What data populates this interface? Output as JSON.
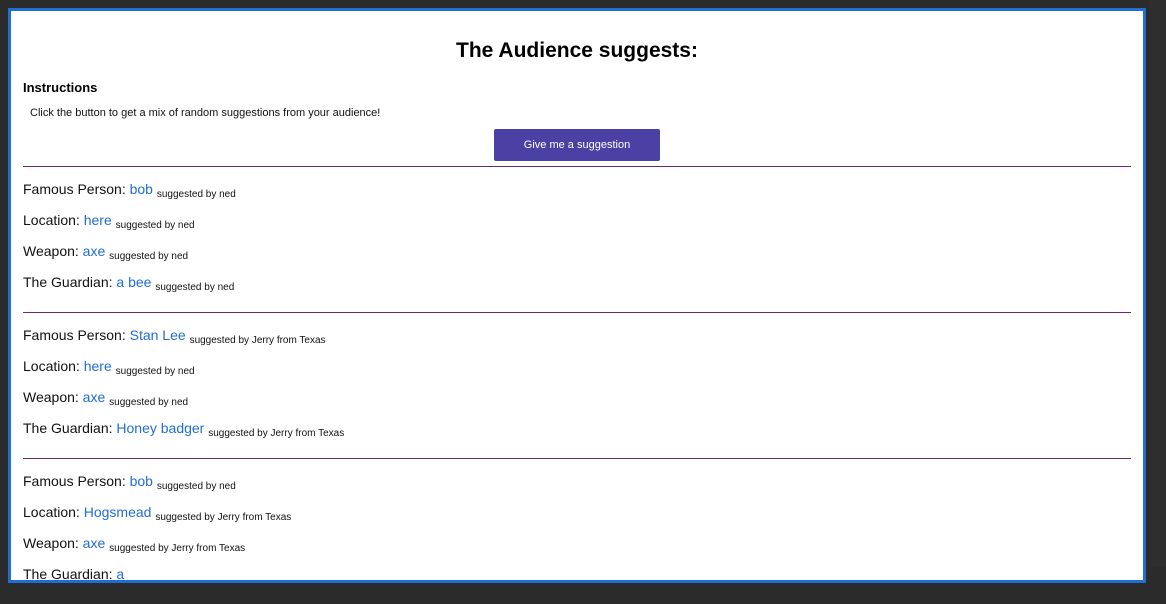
{
  "page": {
    "title": "The Audience suggests:",
    "instructions_heading": "Instructions",
    "instructions_text": "Click the button to get a mix of random suggestions from your audience!",
    "button_label": "Give me a suggestion"
  },
  "groups": [
    {
      "rows": [
        {
          "label": "Famous Person:",
          "value": "bob",
          "by": "suggested by ned"
        },
        {
          "label": "Location:",
          "value": "here",
          "by": "suggested by ned"
        },
        {
          "label": "Weapon:",
          "value": "axe",
          "by": "suggested by ned"
        },
        {
          "label": "The Guardian:",
          "value": "a bee",
          "by": "suggested by ned"
        }
      ]
    },
    {
      "rows": [
        {
          "label": "Famous Person:",
          "value": "Stan Lee",
          "by": "suggested by Jerry from Texas"
        },
        {
          "label": "Location:",
          "value": "here",
          "by": "suggested by ned"
        },
        {
          "label": "Weapon:",
          "value": "axe",
          "by": "suggested by ned"
        },
        {
          "label": "The Guardian:",
          "value": "Honey badger",
          "by": "suggested by Jerry from Texas"
        }
      ]
    },
    {
      "rows": [
        {
          "label": "Famous Person:",
          "value": "bob",
          "by": "suggested by ned"
        },
        {
          "label": "Location:",
          "value": "Hogsmead",
          "by": "suggested by Jerry from Texas"
        },
        {
          "label": "Weapon:",
          "value": "axe",
          "by": "suggested by Jerry from Texas"
        },
        {
          "label": "The Guardian:",
          "value": "a",
          "by": ""
        }
      ]
    }
  ],
  "colors": {
    "accent_button": "#4b40a3",
    "link_value": "#1f6ed4",
    "frame_border": "#1f6ed4",
    "divider": "#6a2a6a"
  }
}
